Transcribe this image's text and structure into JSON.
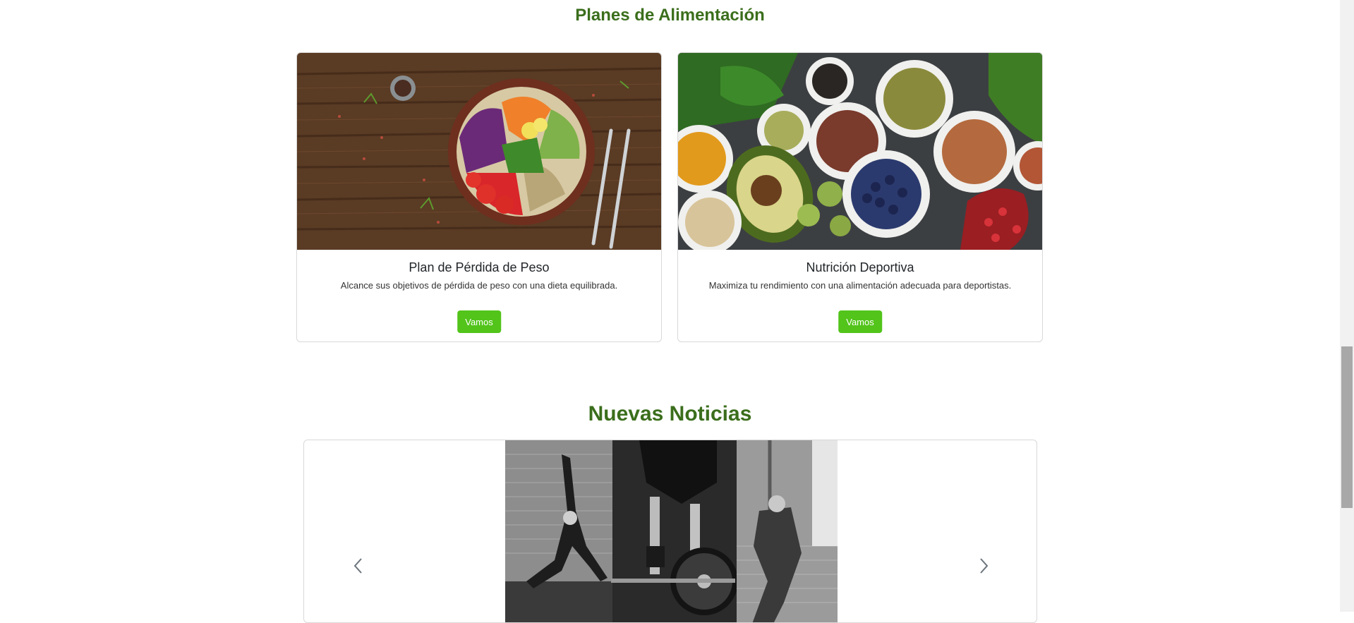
{
  "theme": {
    "title_color": "#3b6e1c",
    "button_color": "#52c41a",
    "text_color": "#212529"
  },
  "plans": {
    "title": "Planes de Alimentación",
    "cards": [
      {
        "name": "Plan de Pérdida de Peso",
        "description": "Alcance sus objetivos de pérdida de peso con una dieta equilibrada.",
        "button": "Vamos",
        "image": "salad-bowl-on-wooden-table"
      },
      {
        "name": "Nutrición Deportiva",
        "description": "Maximiza tu rendimiento con una alimentación adecuada para deportistas.",
        "button": "Vamos",
        "image": "superfoods-bowls-avocado-berries"
      }
    ]
  },
  "news": {
    "title": "Nuevas Noticias",
    "carousel": {
      "image": "black-and-white-gym-workout-collage",
      "prev_icon": "chevron-left-icon",
      "next_icon": "chevron-right-icon"
    }
  }
}
